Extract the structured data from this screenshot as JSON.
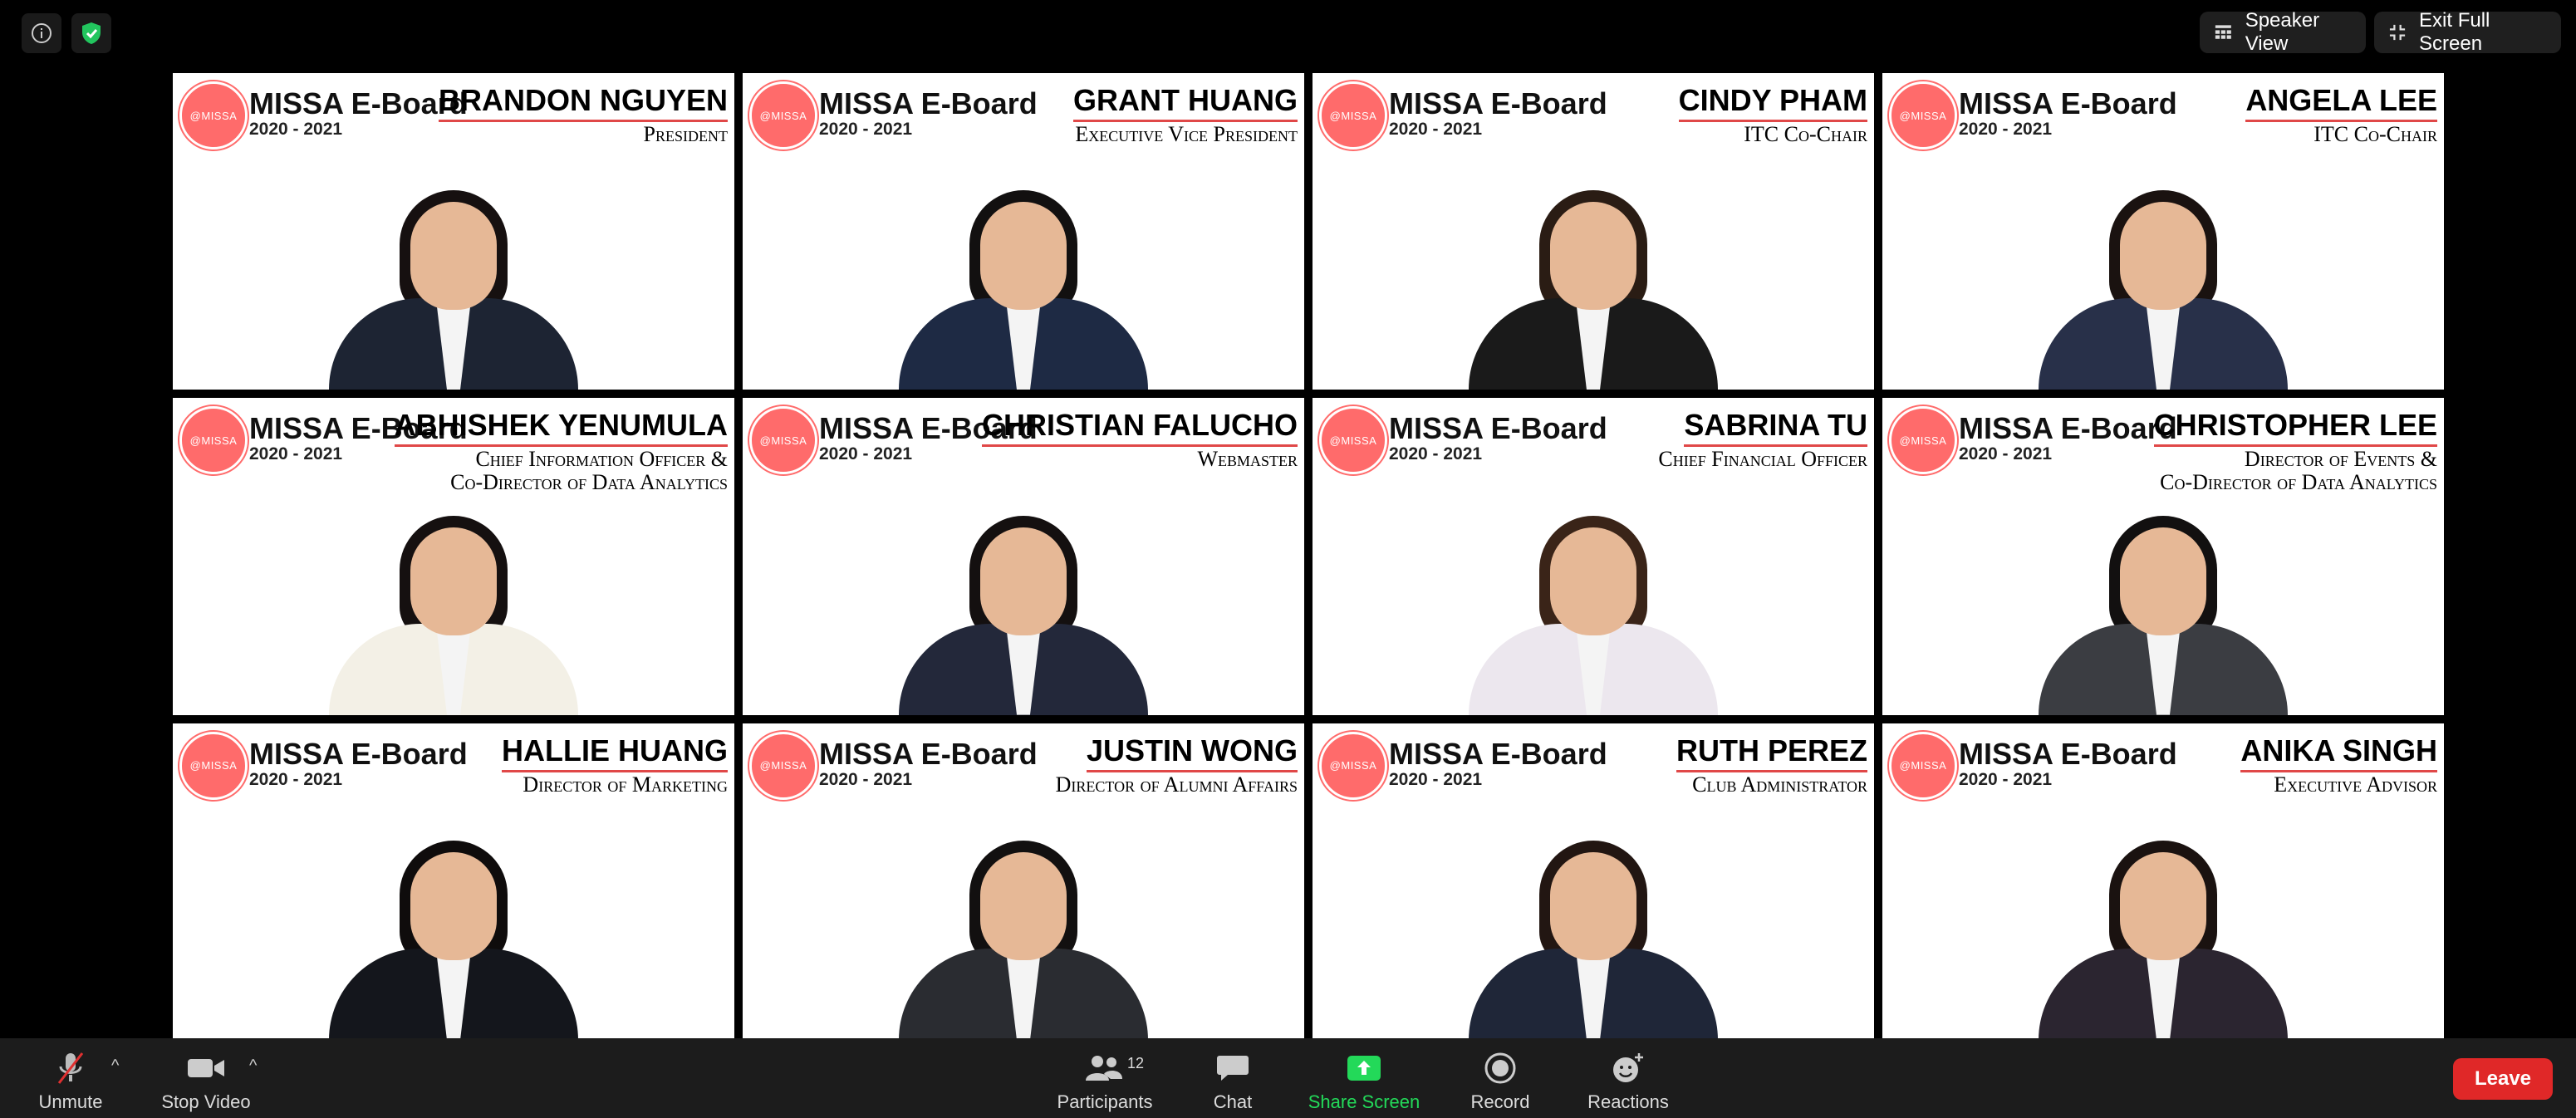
{
  "top": {
    "speaker_view": "Speaker View",
    "exit_fullscreen": "Exit Full Screen"
  },
  "logo_text": "@MISSA",
  "tiles": [
    {
      "org": "MISSA E-Board",
      "year": "2020 - 2021",
      "name": "BRANDON NGUYEN",
      "role": [
        "President"
      ],
      "suit": "#1d2433",
      "hair": "#161010"
    },
    {
      "org": "MISSA E-Board",
      "year": "2020 - 2021",
      "name": "GRANT HUANG",
      "role": [
        "Executive Vice President"
      ],
      "suit": "#1e2a44",
      "hair": "#121010"
    },
    {
      "org": "MISSA E-Board",
      "year": "2020 - 2021",
      "name": "CINDY PHAM",
      "role": [
        "ITC Co-Chair"
      ],
      "suit": "#1a1a1a",
      "hair": "#2a1c14"
    },
    {
      "org": "MISSA E-Board",
      "year": "2020 - 2021",
      "name": "ANGELA LEE",
      "role": [
        "ITC Co-Chair"
      ],
      "suit": "#283049",
      "hair": "#1a1210"
    },
    {
      "org": "MISSA E-Board",
      "year": "2020 - 2021",
      "name": "ABHISHEK YENUMULA",
      "role": [
        "Chief Information Officer &",
        "Co-Director of Data Analytics"
      ],
      "suit": "#f3f0e6",
      "hair": "#151010"
    },
    {
      "org": "MISSA E-Board",
      "year": "2020 - 2021",
      "name": "CHRISTIAN FALUCHO",
      "role": [
        "Webmaster"
      ],
      "suit": "#23283a",
      "hair": "#141010"
    },
    {
      "org": "MISSA E-Board",
      "year": "2020 - 2021",
      "name": "SABRINA TU",
      "role": [
        "Chief Financial Officer"
      ],
      "suit": "#ece7ee",
      "hair": "#3a2418"
    },
    {
      "org": "MISSA E-Board",
      "year": "2020 - 2021",
      "name": "CHRISTOPHER LEE",
      "role": [
        "Director of Events &",
        "Co-Director of Data Analytics"
      ],
      "suit": "#3b3d42",
      "hair": "#121010"
    },
    {
      "org": "MISSA E-Board",
      "year": "2020 - 2021",
      "name": "HALLIE HUANG",
      "role": [
        "Director of Marketing"
      ],
      "suit": "#14161c",
      "hair": "#0f0c0c"
    },
    {
      "org": "MISSA E-Board",
      "year": "2020 - 2021",
      "name": "JUSTIN WONG",
      "role": [
        "Director of Alumni Affairs"
      ],
      "suit": "#2a2c31",
      "hair": "#121010"
    },
    {
      "org": "MISSA E-Board",
      "year": "2020 - 2021",
      "name": "RUTH PEREZ",
      "role": [
        "Club Administrator"
      ],
      "suit": "#1f2638",
      "hair": "#221612"
    },
    {
      "org": "MISSA E-Board",
      "year": "2020 - 2021",
      "name": "ANIKA SINGH",
      "role": [
        "Executive Advisor"
      ],
      "suit": "#2b2530",
      "hair": "#1a1210"
    }
  ],
  "controls": {
    "unmute": "Unmute",
    "stop_video": "Stop Video",
    "participants": "Participants",
    "participants_count": "12",
    "chat": "Chat",
    "share_screen": "Share Screen",
    "record": "Record",
    "reactions": "Reactions",
    "leave": "Leave"
  },
  "colors": {
    "share_green": "#23d959",
    "leave_red": "#e02828",
    "logo_coral": "#ff6b6b",
    "security_green": "#22c55e"
  }
}
